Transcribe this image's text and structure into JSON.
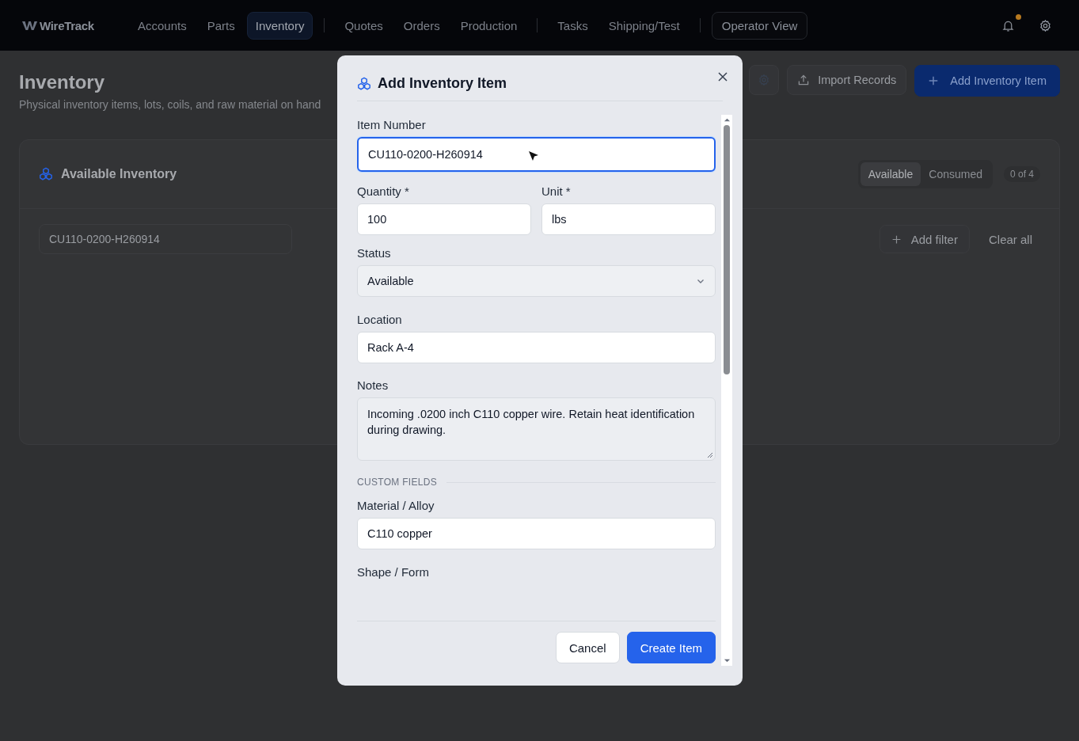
{
  "nav": {
    "brand": "WireTrack",
    "groups": [
      [
        {
          "label": "Accounts",
          "selected": false
        },
        {
          "label": "Parts",
          "selected": false
        },
        {
          "label": "Inventory",
          "selected": true
        }
      ],
      [
        {
          "label": "Quotes",
          "selected": false
        },
        {
          "label": "Orders",
          "selected": false
        },
        {
          "label": "Production",
          "selected": false
        }
      ],
      [
        {
          "label": "Tasks",
          "selected": false
        },
        {
          "label": "Shipping/Test",
          "selected": false
        }
      ]
    ],
    "operator_view": "Operator View",
    "unread_notifications": true
  },
  "page": {
    "title": "Inventory",
    "subtitle": "Physical inventory items, lots, coils, and raw material on hand",
    "import_button": "Import Records",
    "add_button": "Add Inventory Item"
  },
  "panel": {
    "title": "Available Inventory",
    "filters": [
      {
        "label": "Available",
        "selected": true
      },
      {
        "label": "Consumed",
        "selected": false
      }
    ],
    "count": "0 of 4",
    "search_value": "CU110-0200-H260914",
    "add_filter": "Add filter",
    "clear_all": "Clear all"
  },
  "modal": {
    "title": "Add Inventory Item",
    "fields": [
      {
        "kind": "text",
        "label": "Item Number",
        "value": "CU110-0200-H260914",
        "focused": true
      },
      {
        "kind": "row",
        "fields": [
          {
            "kind": "text",
            "label": "Quantity *",
            "value": "100",
            "focused": false
          },
          {
            "kind": "text",
            "label": "Unit *",
            "value": "lbs",
            "focused": false
          }
        ]
      },
      {
        "kind": "select",
        "label": "Status",
        "value": "Available"
      },
      {
        "kind": "text",
        "label": "Location",
        "value": "Rack A-4",
        "focused": false
      },
      {
        "kind": "textarea",
        "label": "Notes",
        "value": "Incoming .0200 inch C110 copper wire. Retain heat identification during drawing."
      },
      {
        "kind": "section",
        "label": "CUSTOM FIELDS"
      },
      {
        "kind": "text",
        "label": "Material / Alloy",
        "value": "C110 copper",
        "focused": false
      },
      {
        "kind": "label",
        "label": "Shape / Form"
      }
    ],
    "cancel": "Cancel",
    "submit": "Create Item"
  }
}
